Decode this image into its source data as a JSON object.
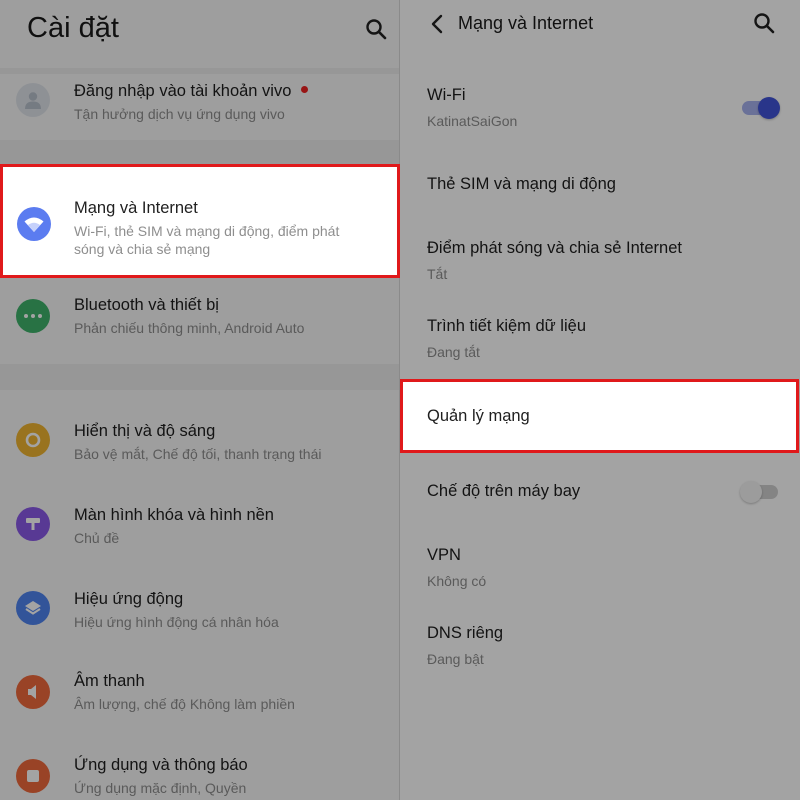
{
  "left": {
    "title": "Cài đặt",
    "account": {
      "title": "Đăng nhập vào tài khoản vivo",
      "subtitle": "Tận hưởng dịch vụ ứng dụng vivo"
    },
    "items": [
      {
        "title": "Mạng và Internet",
        "subtitle": "Wi-Fi, thẻ SIM và mạng di động, điểm phát sóng và chia sẻ mạng",
        "icon": "wifi-icon",
        "color": "#5b7cf0"
      },
      {
        "title": "Bluetooth và thiết bị",
        "subtitle": "Phản chiếu thông minh, Android Auto",
        "icon": "more-dots-icon",
        "color": "#3fb36b"
      },
      {
        "title": "Hiển thị và độ sáng",
        "subtitle": "Bảo vệ mắt, Chế độ tối, thanh trạng thái",
        "icon": "brightness-icon",
        "color": "#f0b431"
      },
      {
        "title": "Màn hình khóa và hình nền",
        "subtitle": "Chủ đề",
        "icon": "wallpaper-icon",
        "color": "#8a59e8"
      },
      {
        "title": "Hiệu ứng động",
        "subtitle": "Hiệu ứng hình động cá nhân hóa",
        "icon": "layers-icon",
        "color": "#4f84f0"
      },
      {
        "title": "Âm thanh",
        "subtitle": "Âm lượng, chế độ Không làm phiền",
        "icon": "speaker-icon",
        "color": "#ef6a3c"
      },
      {
        "title": "Ứng dụng và thông báo",
        "subtitle": "Ứng dụng mặc định, Quyền",
        "icon": "apps-icon",
        "color": "#ef6a3c"
      }
    ]
  },
  "right": {
    "title": "Mạng và Internet",
    "items": [
      {
        "title": "Wi-Fi",
        "subtitle": "KatinatSaiGon",
        "toggle": true
      },
      {
        "title": "Thẻ SIM và mạng di động"
      },
      {
        "title": "Điểm phát sóng và chia sẻ Internet",
        "subtitle": "Tắt"
      },
      {
        "title": "Trình tiết kiệm dữ liệu",
        "subtitle": "Đang tắt"
      },
      {
        "title": "Quản lý mạng"
      },
      {
        "title": "Chế độ trên máy bay",
        "toggle": false
      },
      {
        "title": "VPN",
        "subtitle": "Không có"
      },
      {
        "title": "DNS riêng",
        "subtitle": "Đang bật"
      }
    ]
  },
  "colors": {
    "toggle_on": "#4153d8",
    "toggle_off": "#c4c4c4",
    "highlight": "#e0191b",
    "notification_dot": "#e22222"
  }
}
